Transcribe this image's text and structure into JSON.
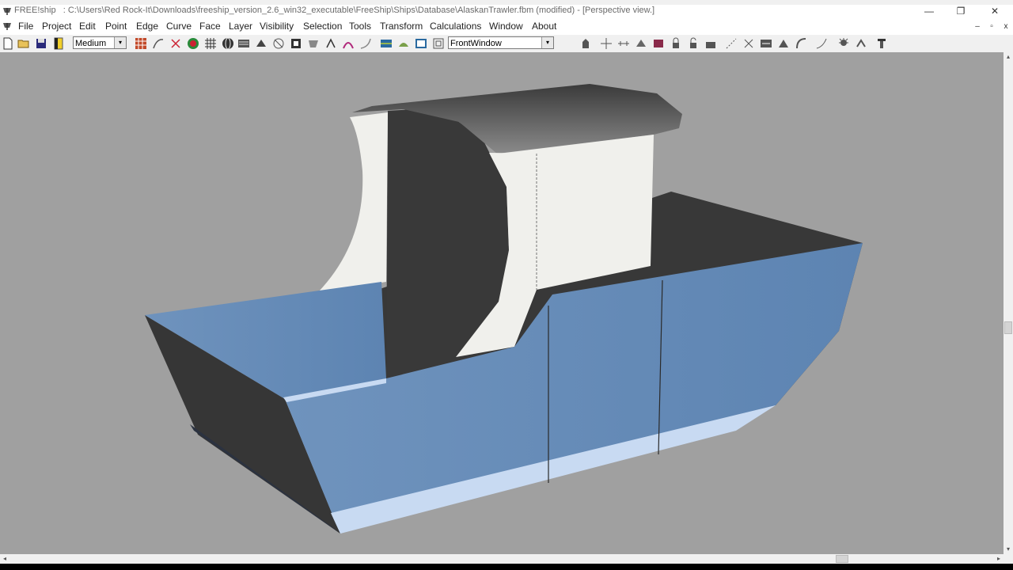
{
  "window": {
    "app_name": "FREE!ship",
    "title": ": C:\\Users\\Red Rock-It\\Downloads\\freeship_version_2.6_win32_executable\\FreeShip\\Ships\\Database\\AlaskanTrawler.fbm (modified) - [Perspective view.]",
    "minimize": "—",
    "restore": "❐",
    "close": "✕"
  },
  "menubar": {
    "items": [
      "File",
      "Project",
      "Edit",
      "Point",
      "Edge",
      "Curve",
      "Face",
      "Layer",
      "Visibility",
      "Selection",
      "Tools",
      "Transform",
      "Calculations",
      "Window",
      "About"
    ],
    "mdi": {
      "minimize": "–",
      "restore": "▫",
      "close": "x"
    }
  },
  "toolbar": {
    "precision_select": "Medium",
    "view_select": "FrontWindow",
    "dropdown_arrow": "▾"
  },
  "colors": {
    "viewport_bg": "#a0a0a0",
    "hull_blue": "#6f93bd",
    "dark_surface": "#383838",
    "white_surface": "#f0f0ec",
    "waterline": "#c8daf2"
  },
  "scroll": {
    "up": "▴",
    "down": "▾",
    "left": "◂",
    "right": "▸"
  }
}
